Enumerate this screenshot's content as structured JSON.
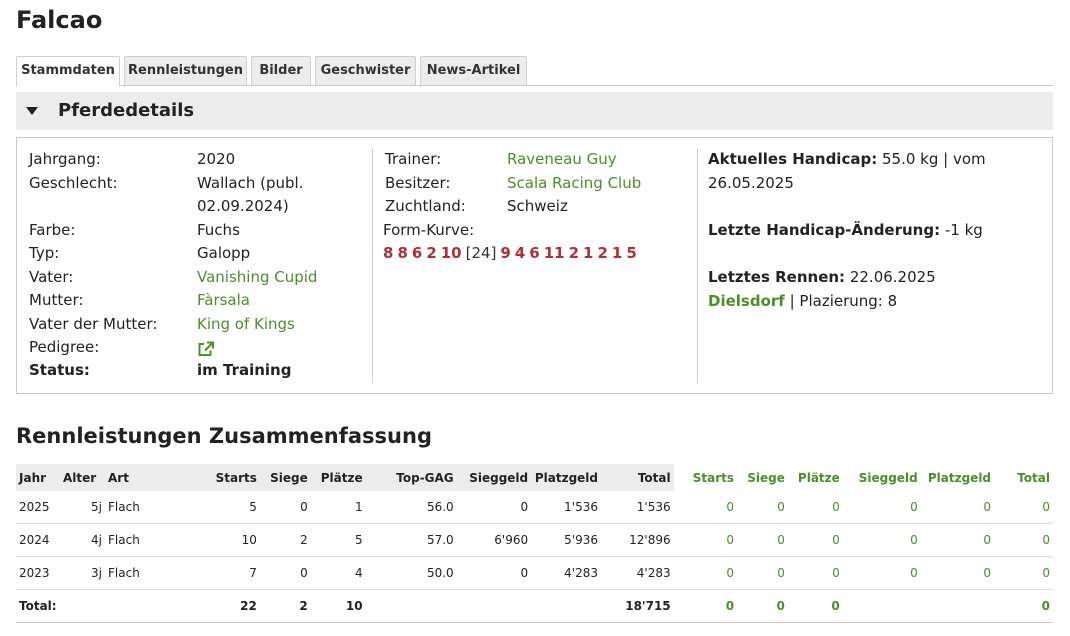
{
  "page_title": "Falcao",
  "tabs": [
    "Stammdaten",
    "Rennleistungen",
    "Bilder",
    "Geschwister",
    "News-Artikel"
  ],
  "section": "Pferdedetails",
  "details": {
    "col1": [
      {
        "label": "Jahrgang:",
        "value": "2020"
      },
      {
        "label": "Geschlecht:",
        "value": "Wallach (publ."
      },
      {
        "label": "",
        "value": "02.09.2024)"
      },
      {
        "label": "Farbe:",
        "value": "Fuchs"
      },
      {
        "label": "Typ:",
        "value": "Galopp"
      },
      {
        "label": "Vater:",
        "value": "Vanishing Cupid"
      },
      {
        "label": "Mutter:",
        "value": "Fàrsala"
      },
      {
        "label": "Vater der Mutter:",
        "value": "King of Kings"
      },
      {
        "label": "Pedigree:",
        "value": ""
      },
      {
        "label": "Status:",
        "value": "im Training"
      }
    ],
    "col2": [
      {
        "label": "Trainer:",
        "value": "Raveneau Guy"
      },
      {
        "label": "Besitzer:",
        "value": "Scala Racing Club"
      },
      {
        "label": "Zuchtland:",
        "value": "Schweiz"
      }
    ],
    "form_label": "Form-Kurve:",
    "form_curve": [
      "8",
      "8",
      "6",
      "2",
      "10",
      "[24]",
      "9",
      "4",
      "6",
      "11",
      "2",
      "1",
      "2",
      "1",
      "5"
    ],
    "handicap_label": "Aktuelles Handicap:",
    "handicap_value": "55.0 kg | vom",
    "handicap_date": "26.05.2025",
    "change_label": "Letzte Handicap-Änderung:",
    "change_value": "-1 kg",
    "last_race_label": "Letztes Rennen:",
    "last_race_date": "22.06.2025",
    "last_race_venue": "Dielsdorf",
    "placement": "| Plazierung: 8"
  },
  "summary": {
    "title": "Rennleistungen Zusammenfassung",
    "headers": [
      "Jahr",
      "Alter",
      "Art",
      "Starts",
      "Siege",
      "Plätze",
      "Top-GAG",
      "Sieggeld",
      "Platzgeld",
      "Total",
      "Starts",
      "Siege",
      "Plätze",
      "Sieggeld",
      "Platzgeld",
      "Total"
    ],
    "rows": [
      [
        "2025",
        "5j",
        "Flach",
        "5",
        "0",
        "1",
        "56.0",
        "0",
        "1'536",
        "1'536",
        "0",
        "0",
        "0",
        "0",
        "0",
        "0"
      ],
      [
        "2024",
        "4j",
        "Flach",
        "10",
        "2",
        "5",
        "57.0",
        "6'960",
        "5'936",
        "12'896",
        "0",
        "0",
        "0",
        "0",
        "0",
        "0"
      ],
      [
        "2023",
        "3j",
        "Flach",
        "7",
        "0",
        "4",
        "50.0",
        "0",
        "4'283",
        "4'283",
        "0",
        "0",
        "0",
        "0",
        "0",
        "0"
      ]
    ],
    "total": [
      "Total:",
      "",
      "",
      "22",
      "2",
      "10",
      "",
      "",
      "",
      "18'715",
      "0",
      "0",
      "0",
      "",
      "",
      "0"
    ]
  },
  "colors": {
    "link_green": "#4a8f2a",
    "form_red": "#b03038",
    "header_bg": "#ececec"
  },
  "icons": {
    "pedigree": "external-link-icon",
    "accordion": "caret-down-icon"
  }
}
